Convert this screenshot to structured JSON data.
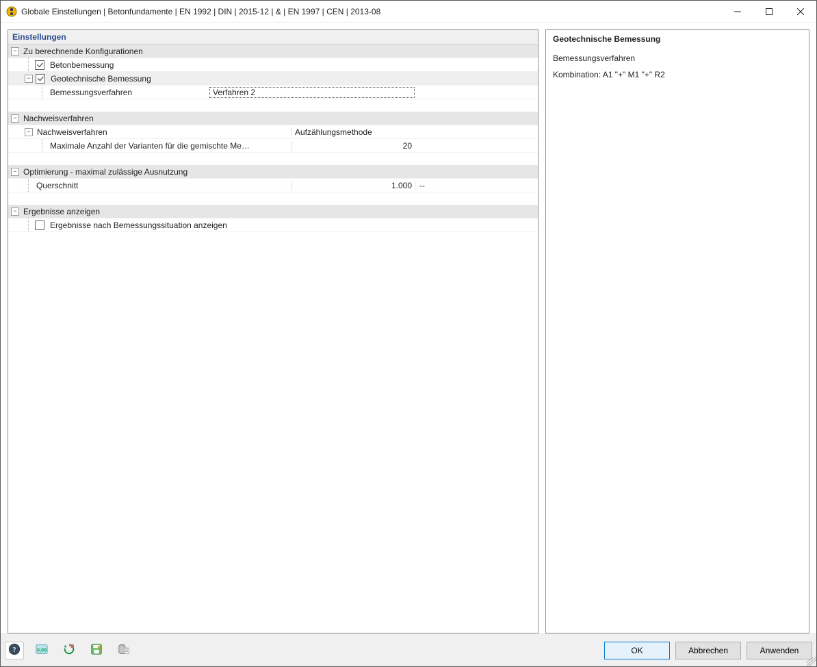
{
  "window": {
    "title": "Globale Einstellungen | Betonfundamente | EN 1992 | DIN | 2015-12 | & | EN 1997 | CEN | 2013-08"
  },
  "left_panel": {
    "header": "Einstellungen",
    "sections": {
      "configs": {
        "title": "Zu berechnende Konfigurationen",
        "betonbemessung": {
          "label": "Betonbemessung",
          "checked": true
        },
        "geotech": {
          "label": "Geotechnische Bemessung",
          "checked": true,
          "bemessungsverfahren_label": "Bemessungsverfahren",
          "bemessungsverfahren_value": "Verfahren 2"
        }
      },
      "nachweis": {
        "title": "Nachweisverfahren",
        "verfahren_label": "Nachweisverfahren",
        "verfahren_value": "Aufzählungsmethode",
        "max_variants_label": "Maximale Anzahl der Varianten für die gemischte Me…",
        "max_variants_value": "20"
      },
      "optimierung": {
        "title": "Optimierung - maximal zulässige Ausnutzung",
        "querschnitt_label": "Querschnitt",
        "querschnitt_value": "1.000",
        "querschnitt_unit": "--"
      },
      "ergebnisse": {
        "title": "Ergebnisse anzeigen",
        "show_by_situation_label": "Ergebnisse nach Bemessungssituation anzeigen",
        "show_by_situation_checked": false
      }
    }
  },
  "right_panel": {
    "title": "Geotechnische Bemessung",
    "bemessungsverfahren_label": "Bemessungsverfahren",
    "combination_label": "Kombination: A1 \"+\" M1 \"+\" R2"
  },
  "buttons": {
    "ok": "OK",
    "cancel": "Abbrechen",
    "apply": "Anwenden"
  },
  "toolbar_icons": {
    "help": "help-icon",
    "decimal": "decimal-places-icon",
    "restore": "restore-defaults-icon",
    "save": "save-settings-icon",
    "data": "data-icon"
  }
}
